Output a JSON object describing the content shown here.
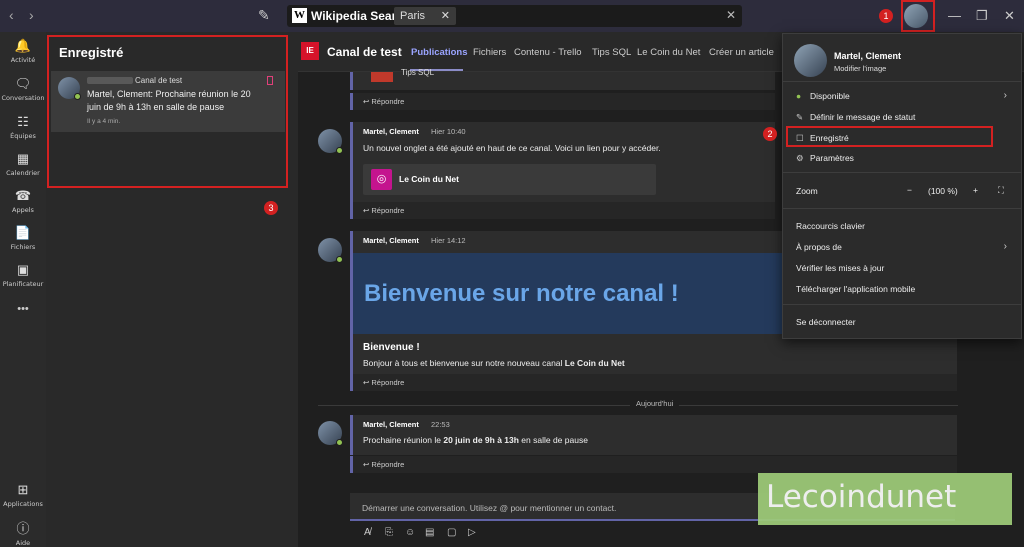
{
  "titlebar": {
    "search_title": "Wikipedia Search",
    "search_chip": "Paris",
    "search_chip_close": "✕",
    "search_clear": "✕"
  },
  "annotations": {
    "n1": "1",
    "n2": "2",
    "n3": "3"
  },
  "rail": {
    "items": [
      {
        "label": "Activité",
        "icon": "bell-icon"
      },
      {
        "label": "Conversation",
        "icon": "chat-icon"
      },
      {
        "label": "Équipes",
        "icon": "teams-icon"
      },
      {
        "label": "Calendrier",
        "icon": "calendar-icon"
      },
      {
        "label": "Appels",
        "icon": "phone-icon"
      },
      {
        "label": "Fichiers",
        "icon": "file-icon"
      },
      {
        "label": "Planificateur",
        "icon": "planner-icon"
      },
      {
        "label": "Applications",
        "icon": "apps-icon"
      },
      {
        "label": "Aide",
        "icon": "help-icon"
      }
    ],
    "more": "•••"
  },
  "saved": {
    "title": "Enregistré",
    "item": {
      "channel": "Canal de test",
      "message": "Martel, Clement: Prochaine réunion le 20 juin de 9h à 13h en salle de pause",
      "time": "Il y a 4 min."
    }
  },
  "channel": {
    "logo": "IE",
    "name": "Canal de test",
    "tabs": [
      "Publications",
      "Fichiers",
      "Contenu - Trello",
      "Tips SQL",
      "Le Coin du Net",
      "Créer un article"
    ],
    "posts": [
      {
        "author": "Martel, Clement",
        "time": "Hier 10:40",
        "body": "Un nouvel onglet a été ajouté en haut de ce canal. Voici un lien pour y accéder.",
        "card": "Le Coin du Net"
      },
      {
        "author": "Martel, Clement",
        "time": "Hier 14:12",
        "banner": "Bienvenue sur notre canal !",
        "heading": "Bienvenue !",
        "body_prefix": "Bonjour à tous et bienvenue sur notre nouveau canal ",
        "body_bold": "Le Coin du Net"
      },
      {
        "author": "Martel, Clement",
        "time": "22:53",
        "body_prefix": "Prochaine réunion le ",
        "body_bold": "20 juin de 9h à 13h",
        "body_suffix": " en salle de pause"
      }
    ],
    "top_card": "Tips SQL",
    "reply_label": "Répondre",
    "separator": "Aujourd'hui",
    "composer_placeholder": "Démarrer une conversation. Utilisez @ pour mentionner un contact."
  },
  "menu": {
    "name": "Martel, Clement",
    "edit_image": "Modifier l'image",
    "status": "Disponible",
    "set_status": "Définir le message de statut",
    "saved": "Enregistré",
    "settings": "Paramètres",
    "zoom_label": "Zoom",
    "zoom_minus": "−",
    "zoom_value": "(100 %)",
    "zoom_plus": "+",
    "shortcuts": "Raccourcis clavier",
    "about": "À propos de",
    "check_updates": "Vérifier les mises à jour",
    "download_mobile": "Télécharger l'application mobile",
    "sign_out": "Se déconnecter",
    "status_color": "#92c353"
  },
  "watermark": "Lecoindunet"
}
